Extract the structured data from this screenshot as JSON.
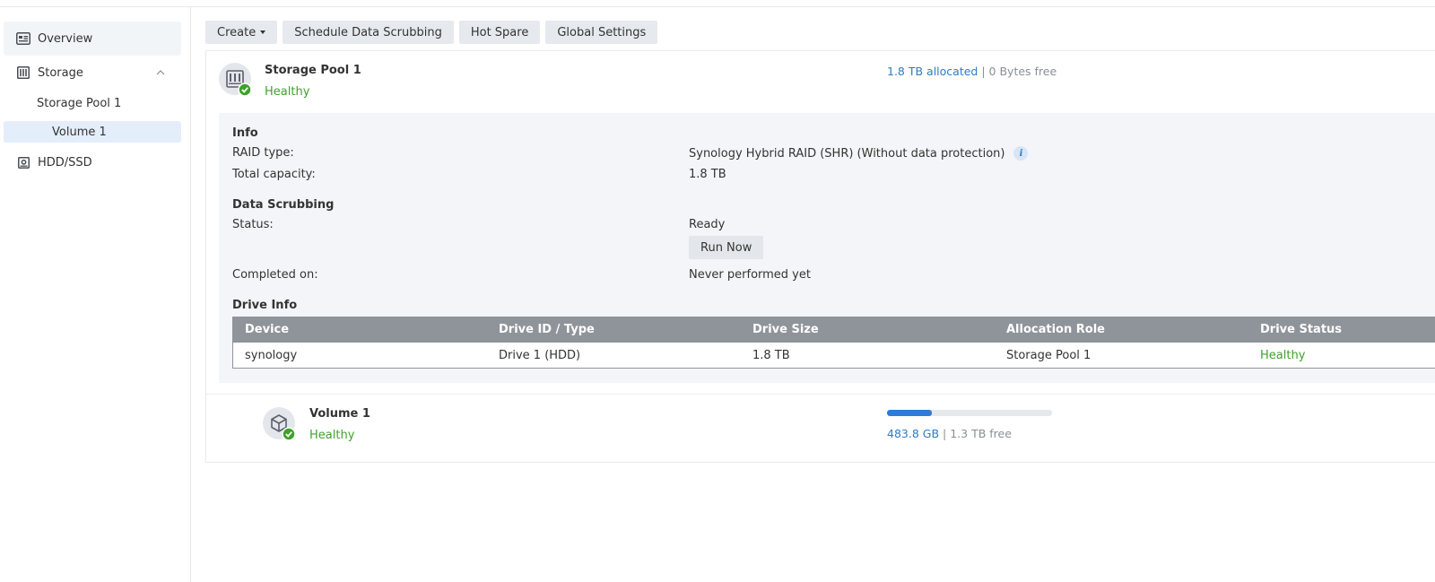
{
  "sidebar": {
    "overview": "Overview",
    "storage": "Storage",
    "storage_pool": "Storage Pool 1",
    "volume": "Volume 1",
    "hdd": "HDD/SSD"
  },
  "toolbar": {
    "create": "Create",
    "schedule": "Schedule Data Scrubbing",
    "hot_spare": "Hot Spare",
    "global_settings": "Global Settings"
  },
  "pool": {
    "title": "Storage Pool 1",
    "status": "Healthy",
    "allocated": "1.8 TB allocated",
    "separator": "|",
    "free": "0 Bytes free",
    "info": {
      "title": "Info",
      "raid_label": "RAID type:",
      "raid_value": "Synology Hybrid RAID (SHR) (Without data protection)",
      "capacity_label": "Total capacity:",
      "capacity_value": "1.8 TB"
    },
    "scrubbing": {
      "title": "Data Scrubbing",
      "status_label": "Status:",
      "status_value": "Ready",
      "run_now": "Run Now",
      "completed_label": "Completed on:",
      "completed_value": "Never performed yet"
    },
    "drive_info": {
      "title": "Drive Info",
      "columns": [
        "Device",
        "Drive ID / Type",
        "Drive Size",
        "Allocation Role",
        "Drive Status"
      ],
      "rows": [
        [
          "synology",
          "Drive 1 (HDD)",
          "1.8 TB",
          "Storage Pool 1",
          "Healthy"
        ]
      ]
    }
  },
  "volume": {
    "title": "Volume 1",
    "status": "Healthy",
    "used": "483.8 GB",
    "separator": "|",
    "free": "1.3 TB free",
    "usage_fraction": 0.27
  },
  "colors": {
    "healthy": "#3fa12c",
    "accent": "#2f7bc4",
    "table_header": "#8f949a"
  },
  "icons": {
    "overview": "overview-icon",
    "storage": "storage-icon",
    "hdd": "hdd-icon",
    "pool": "storage-pool-icon",
    "volume": "volume-cube-icon",
    "check": "check-badge-icon",
    "info": "info-icon"
  }
}
